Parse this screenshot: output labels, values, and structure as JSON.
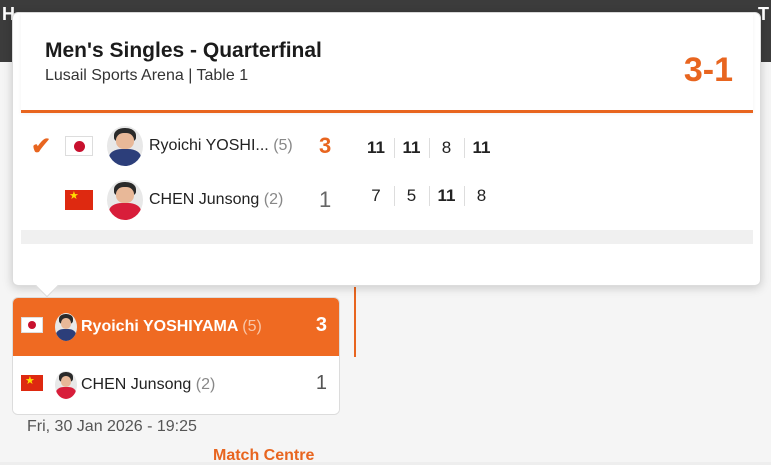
{
  "background": {
    "left_letter": "H",
    "right_letter": "T"
  },
  "popover": {
    "title": "Men's Singles - Quarterfinal",
    "venue": "Lusail Sports Arena | Table 1",
    "score": "3-1",
    "players": [
      {
        "name": "Ryoichi YOSHI...",
        "seed": "(5)",
        "sets": "3",
        "games": [
          "11",
          "11",
          "8",
          "11"
        ],
        "winner": true,
        "country": "Japan"
      },
      {
        "name": "CHEN Junsong",
        "seed": "(2)",
        "sets": "1",
        "games": [
          "7",
          "5",
          "11",
          "8"
        ],
        "winner": false,
        "country": "China"
      }
    ]
  },
  "card": {
    "players": [
      {
        "name": "Ryoichi YOSHIYAMA",
        "seed": "(5)",
        "score": "3",
        "winner": true
      },
      {
        "name": "CHEN Junsong",
        "seed": "(2)",
        "score": "1",
        "winner": false
      }
    ],
    "datetime": "Fri, 30 Jan 2026 - 19:25",
    "match_centre": "Match Centre"
  },
  "colors": {
    "accent": "#e8651f",
    "card_winner_bg": "#ef6a22"
  }
}
